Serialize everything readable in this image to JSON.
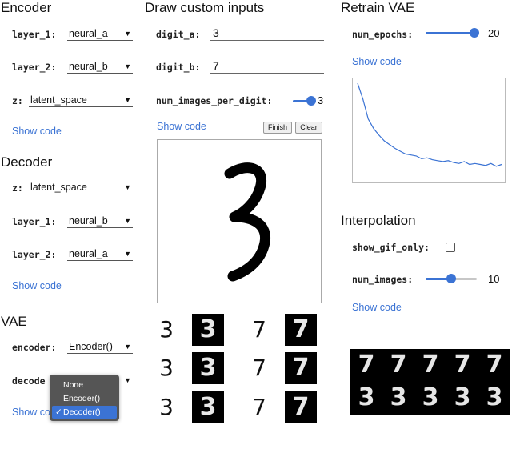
{
  "encoder": {
    "heading": "Encoder",
    "layer_1_label": "layer_1:",
    "layer_1_value": "neural_a",
    "layer_2_label": "layer_2:",
    "layer_2_value": "neural_b",
    "z_label": "z:",
    "z_value": "latent_space",
    "show_code": "Show code"
  },
  "decoder": {
    "heading": "Decoder",
    "z_label": "z:",
    "z_value": "latent_space",
    "layer_1_label": "layer_1:",
    "layer_1_value": "neural_b",
    "layer_2_label": "layer_2:",
    "layer_2_value": "neural_a",
    "show_code": "Show code"
  },
  "vae": {
    "heading": "VAE",
    "encoder_label": "encoder:",
    "encoder_value": "Encoder()",
    "decoder_label": "decode",
    "show_code": "Show co",
    "menu": {
      "options": [
        "None",
        "Encoder()",
        "Decoder()"
      ],
      "selected_index": 2,
      "check": "✓"
    }
  },
  "draw": {
    "heading": "Draw custom inputs",
    "digit_a_label": "digit_a:",
    "digit_a_value": "3",
    "digit_b_label": "digit_b:",
    "digit_b_value": "7",
    "num_images_label": "num_images_per_digit:",
    "num_images_value": "3",
    "num_images_fraction": 0.9,
    "show_code": "Show code",
    "finish_button": "Finish",
    "clear_button": "Clear",
    "canvas_digit": "3",
    "grid": [
      {
        "a": "3",
        "a_rec": "3",
        "b": "7",
        "b_rec": "7"
      },
      {
        "a": "3",
        "a_rec": "3",
        "b": "7",
        "b_rec": "7"
      },
      {
        "a": "3",
        "a_rec": "3",
        "b": "7",
        "b_rec": "7"
      }
    ]
  },
  "retrain": {
    "heading": "Retrain VAE",
    "num_epochs_label": "num_epochs:",
    "num_epochs_value": "20",
    "num_epochs_fraction": 0.95,
    "show_code": "Show code",
    "loss_curve": [
      1.0,
      0.83,
      0.62,
      0.52,
      0.45,
      0.39,
      0.35,
      0.31,
      0.28,
      0.25,
      0.24,
      0.23,
      0.2,
      0.21,
      0.19,
      0.18,
      0.17,
      0.18,
      0.16,
      0.15,
      0.17,
      0.14,
      0.15,
      0.14,
      0.13,
      0.15,
      0.12,
      0.14
    ]
  },
  "interpolation": {
    "heading": "Interpolation",
    "show_gif_label": "show_gif_only:",
    "show_gif_checked": false,
    "num_images_label": "num_images:",
    "num_images_value": "10",
    "num_images_fraction": 0.5,
    "show_code": "Show code",
    "top_row": [
      "7",
      "7",
      "7",
      "7",
      "7"
    ],
    "bottom_row": [
      "3",
      "3",
      "3",
      "3",
      "3"
    ]
  },
  "colors": {
    "accent": "#3b73d4",
    "menu_bg": "#555555"
  }
}
